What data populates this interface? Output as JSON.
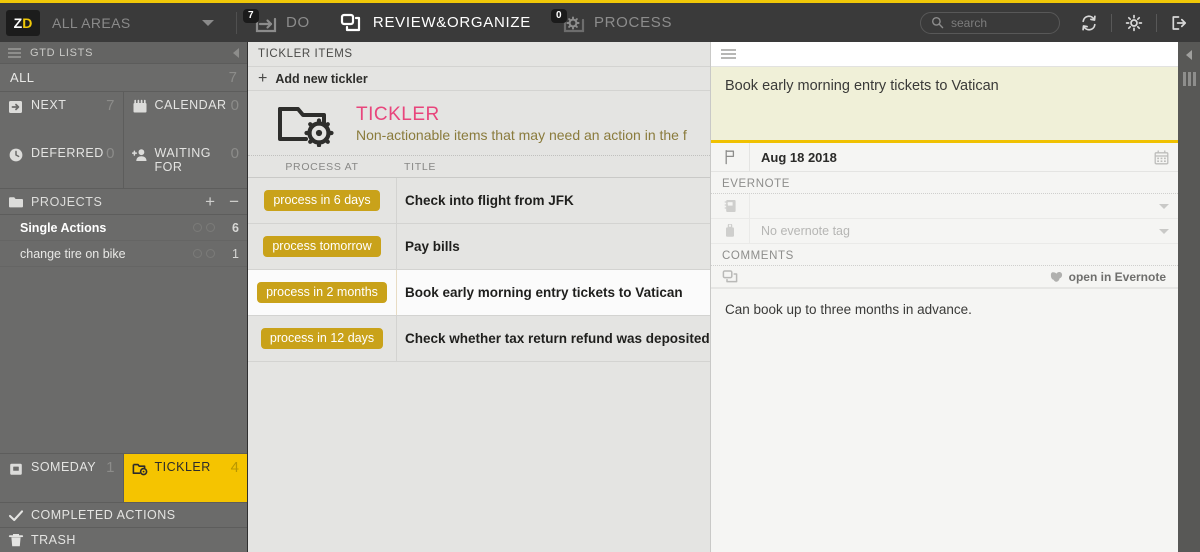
{
  "topbar": {
    "logo": "ZD",
    "area_selector": {
      "label": "ALL AREAS",
      "icon": "chevron-down-icon"
    },
    "modes": [
      {
        "id": "do",
        "label": "DO",
        "badge": "7",
        "icon": "arrow-into-box-icon",
        "active": false
      },
      {
        "id": "review-organize",
        "label": "REVIEW&ORGANIZE",
        "badge": "",
        "icon": "copy-stack-icon",
        "active": true
      },
      {
        "id": "process",
        "label": "PROCESS",
        "badge": "0",
        "icon": "gear-icon",
        "active": false
      }
    ],
    "search": {
      "placeholder": "search",
      "value": "",
      "icon": "search-icon"
    },
    "actions": [
      {
        "id": "sync",
        "icon": "sync-icon"
      },
      {
        "id": "settings",
        "icon": "gear-icon"
      },
      {
        "id": "logout",
        "icon": "logout-icon"
      }
    ]
  },
  "sidebar": {
    "header": {
      "title": "GTD LISTS",
      "menu_icon": "hamburger-icon",
      "collapse_icon": "chevron-left-icon"
    },
    "all": {
      "label": "ALL",
      "count": "7"
    },
    "quad": [
      {
        "id": "next",
        "label": "NEXT",
        "count": "7",
        "icon": "next-arrow-icon"
      },
      {
        "id": "calendar",
        "label": "CALENDAR",
        "count": "0",
        "icon": "calendar-icon"
      },
      {
        "id": "deferred",
        "label": "DEFERRED",
        "count": "0",
        "icon": "clock-icon"
      },
      {
        "id": "waiting-for",
        "label": "WAITING FOR",
        "count": "0",
        "icon": "person-plus-icon"
      }
    ],
    "projects": {
      "label": "PROJECTS",
      "icon": "folder-icon",
      "add_label": "+",
      "remove_label": "−",
      "items": [
        {
          "name": "Single Actions",
          "count": "6",
          "bold": true
        },
        {
          "name": "change tire on bike",
          "count": "1",
          "bold": false
        }
      ]
    },
    "bottom": [
      {
        "id": "someday",
        "label": "SOMEDAY",
        "count": "1",
        "icon": "someday-box-icon",
        "selected": false
      },
      {
        "id": "tickler",
        "label": "TICKLER",
        "count": "4",
        "icon": "tickler-folder-icon",
        "selected": true
      }
    ],
    "lines": [
      {
        "id": "completed-actions",
        "label": "COMPLETED ACTIONS",
        "icon": "check-icon"
      },
      {
        "id": "trash",
        "label": "TRASH",
        "icon": "trash-icon"
      }
    ]
  },
  "list": {
    "header": "TICKLER ITEMS",
    "add_new": {
      "label": "Add new tickler",
      "icon": "plus-icon"
    },
    "banner": {
      "icon": "tickler-folder-gear-icon",
      "title": "TICKLER",
      "title_color": "#e8457c",
      "description": "Non-actionable items that may need an action in the f"
    },
    "columns": {
      "when": "PROCESS AT",
      "title": "TITLE"
    },
    "rows": [
      {
        "when": "process in 6 days",
        "title": "Check into flight from JFK",
        "selected": false
      },
      {
        "when": "process tomorrow",
        "title": "Pay bills",
        "selected": false
      },
      {
        "when": "process in 2 months",
        "title": "Book early morning entry tickets to Vatican",
        "selected": true
      },
      {
        "when": "process in 12 days",
        "title": "Check whether tax return refund was deposited",
        "selected": false
      }
    ]
  },
  "detail": {
    "menu_icon": "hamburger-icon",
    "title": "Book early morning entry tickets to Vatican",
    "date": {
      "value": "Aug 18 2018",
      "flag_icon": "flag-icon",
      "calendar_icon": "calendar-icon"
    },
    "evernote": {
      "section_label": "EVERNOTE",
      "notebook": {
        "icon": "notebook-icon",
        "value": "",
        "chevron": "chevron-down-icon"
      },
      "tag": {
        "icon": "tag-icon",
        "value": "No evernote tag",
        "chevron": "chevron-down-icon"
      }
    },
    "comments": {
      "section_label": "COMMENTS",
      "tool_icon": "copy-stack-icon",
      "open_in_evernote": {
        "label": "open in Evernote",
        "icon": "evernote-elephant-icon"
      },
      "body": "Can book up to three months in advance."
    },
    "rail": {
      "collapse_icon": "chevron-left-icon",
      "grip_icon": "grip-icon"
    }
  },
  "colors": {
    "accent": "#f0c808",
    "selection": "#f5c400",
    "chip": "#c9a21a",
    "pink": "#e8457c"
  }
}
